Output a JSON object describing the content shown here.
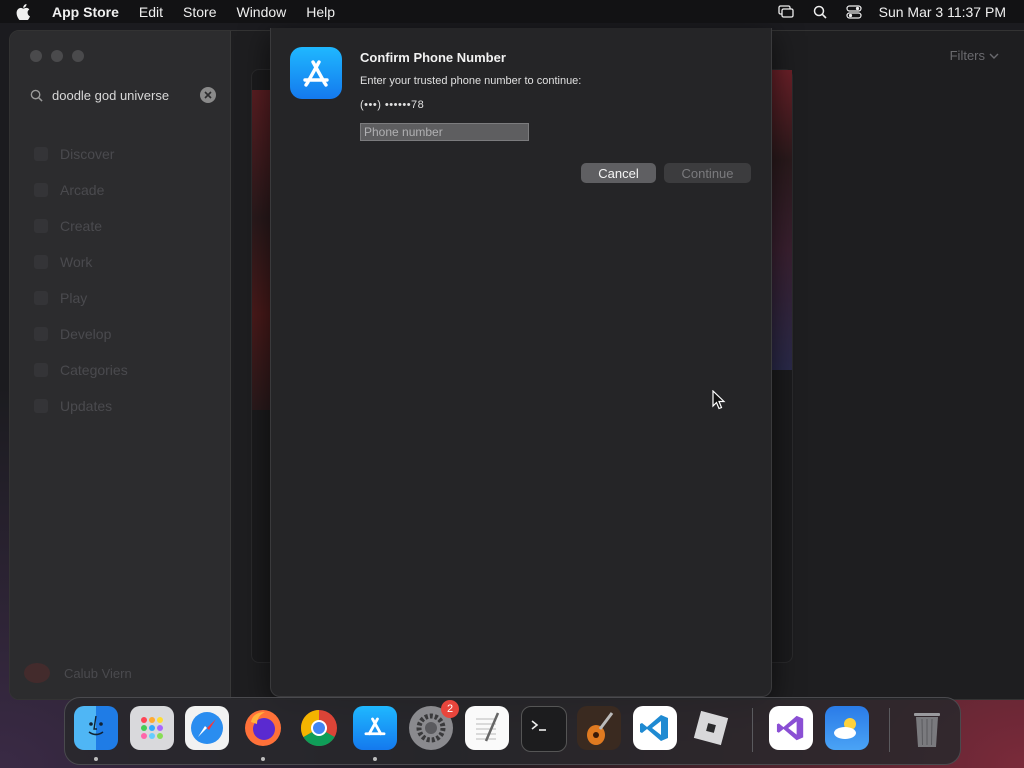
{
  "menubar": {
    "app_name": "App Store",
    "menus": [
      "Edit",
      "Store",
      "Window",
      "Help"
    ],
    "clock": "Sun Mar 3  11:37 PM"
  },
  "sidebar": {
    "search_value": "doodle god universe",
    "items": [
      {
        "label": "Discover"
      },
      {
        "label": "Arcade"
      },
      {
        "label": "Create"
      },
      {
        "label": "Work"
      },
      {
        "label": "Play"
      },
      {
        "label": "Develop"
      },
      {
        "label": "Categories"
      },
      {
        "label": "Updates"
      }
    ],
    "user_name": "Calub Viern"
  },
  "main": {
    "filters_label": "Filters"
  },
  "dialog": {
    "title": "Confirm Phone Number",
    "message": "Enter your trusted phone number to continue:",
    "masked_phone": "(•••) ••••••78",
    "input_placeholder": "Phone number",
    "input_value": "",
    "cancel_label": "Cancel",
    "continue_label": "Continue"
  },
  "dock": {
    "settings_badge": "2",
    "apps": [
      "Finder",
      "Launchpad",
      "Safari",
      "Firefox",
      "Chrome",
      "App Store",
      "System Settings",
      "TextEdit",
      "Terminal",
      "GarageBand",
      "Visual Studio Code",
      "Roblox",
      "Visual Studio",
      "Weather",
      "Trash"
    ]
  },
  "colors": {
    "accent_blue": "#1479ee",
    "badge_red": "#e8453c"
  }
}
